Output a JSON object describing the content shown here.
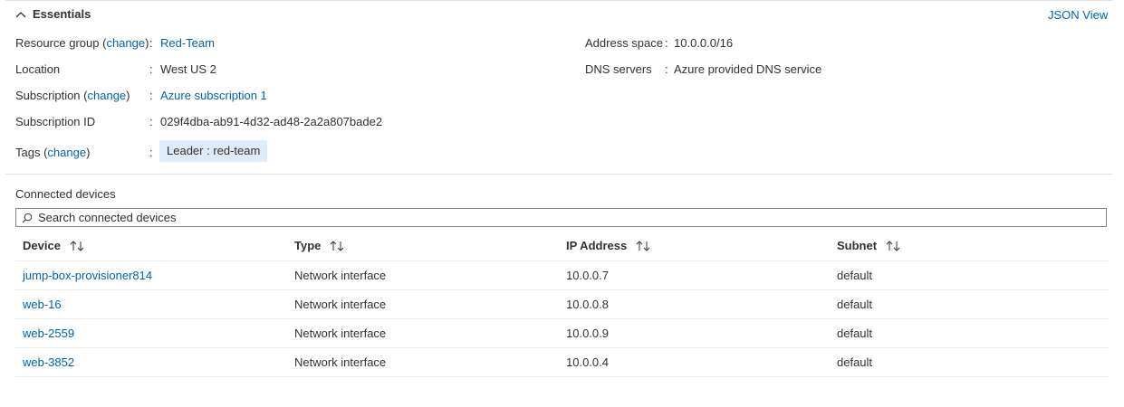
{
  "essentials": {
    "title": "Essentials",
    "json_view": "JSON View",
    "resource_group": {
      "label": "Resource group",
      "change": "change",
      "colon": ":",
      "value": "Red-Team"
    },
    "location": {
      "label": "Location",
      "colon": ":",
      "value": "West US 2"
    },
    "subscription": {
      "label": "Subscription",
      "change": "change",
      "colon": ":",
      "value": "Azure subscription 1"
    },
    "subscription_id": {
      "label": "Subscription ID",
      "colon": ":",
      "value": "029f4dba-ab91-4d32-ad48-2a2a807bade2"
    },
    "tags": {
      "label": "Tags",
      "change": "change",
      "colon": ":",
      "value": "Leader : red-team"
    },
    "address_space": {
      "label": "Address space",
      "colon": ":",
      "value": "10.0.0.0/16"
    },
    "dns_servers": {
      "label": "DNS servers",
      "colon": ":",
      "value": "Azure provided DNS service"
    }
  },
  "connected_devices": {
    "title": "Connected devices",
    "search_placeholder": "Search connected devices",
    "columns": {
      "device": "Device",
      "type": "Type",
      "ip": "IP Address",
      "subnet": "Subnet"
    },
    "rows": [
      {
        "device": "jump-box-provisioner814",
        "type": "Network interface",
        "ip": "10.0.0.7",
        "subnet": "default"
      },
      {
        "device": "web-16",
        "type": "Network interface",
        "ip": "10.0.0.8",
        "subnet": "default"
      },
      {
        "device": "web-2559",
        "type": "Network interface",
        "ip": "10.0.0.9",
        "subnet": "default"
      },
      {
        "device": "web-3852",
        "type": "Network interface",
        "ip": "10.0.0.4",
        "subnet": "default"
      }
    ]
  },
  "colors": {
    "link": "#0062ad",
    "tag_bg": "#deecf9",
    "border": "#8a8886",
    "divider": "#e1dfdd"
  }
}
